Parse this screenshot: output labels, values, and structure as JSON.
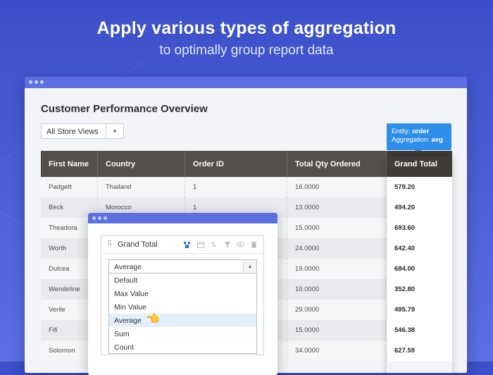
{
  "hero": {
    "title": "Apply various types of aggregation",
    "subtitle": "to optimally group report data"
  },
  "report": {
    "title": "Customer Performance Overview",
    "store_filter": {
      "selected": "All Store Views"
    }
  },
  "tooltip": {
    "entity_label": "Entity:",
    "entity_value": "order",
    "aggregation_label": "Aggregation:",
    "aggregation_value": "avg"
  },
  "table": {
    "columns": [
      "First Name",
      "Country",
      "Order ID",
      "Total Qty Ordered",
      "Grand Total"
    ],
    "rows": [
      [
        "Padgett",
        "Thailand",
        "1",
        "16.0000",
        "579.20"
      ],
      [
        "Beck",
        "Morocco",
        "1",
        "13.0000",
        "494.20"
      ],
      [
        "Theadora",
        "",
        "",
        "15.0000",
        "693.60"
      ],
      [
        "Worth",
        "",
        "",
        "24.0000",
        "642.40"
      ],
      [
        "Dulcea",
        "",
        "",
        "19.0000",
        "684.00"
      ],
      [
        "Wendeline",
        "",
        "",
        "10.0000",
        "352.80"
      ],
      [
        "Verile",
        "",
        "",
        "29.0000",
        "495.79"
      ],
      [
        "Fifi",
        "",
        "",
        "15.0000",
        "546.38"
      ],
      [
        "Solomon",
        "",
        "",
        "34.0000",
        "627.59"
      ]
    ]
  },
  "column_settings": {
    "column_name": "Grand Total",
    "aggregation_selected": "Average",
    "options": [
      "Default",
      "Max Value",
      "Min Value",
      "Average",
      "Sum",
      "Count"
    ],
    "highlighted_option": "Average"
  },
  "colors": {
    "accent": "#5c6fe0",
    "tooltip": "#2e8fe8",
    "table_header": "#524f4d"
  },
  "icons": {
    "grip": "drag-handle-icon",
    "aggregate": "aggregate-icon",
    "calendar": "calendar-icon",
    "sort": "sort-icon",
    "filter": "filter-icon",
    "visibility": "eye-icon",
    "delete": "trash-icon",
    "cursor": "pointing-hand-icon"
  }
}
